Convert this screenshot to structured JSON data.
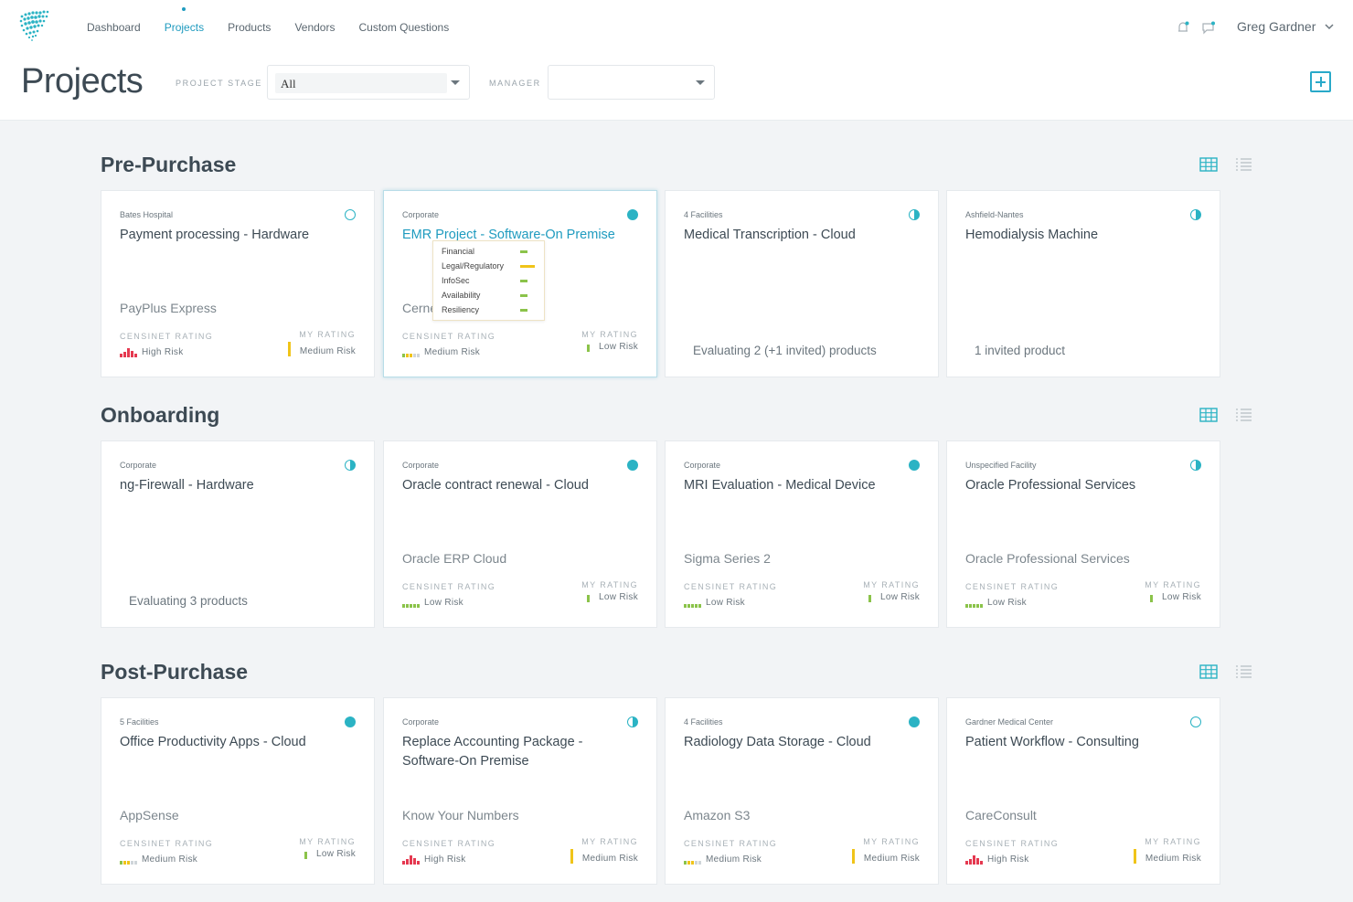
{
  "nav": {
    "items": [
      "Dashboard",
      "Projects",
      "Products",
      "Vendors",
      "Custom Questions"
    ],
    "active": "Projects"
  },
  "user": {
    "name": "Greg Gardner"
  },
  "page": {
    "title": "Projects"
  },
  "filters": {
    "stage_label": "PROJECT STAGE",
    "stage_value": "All",
    "manager_label": "MANAGER",
    "manager_value": ""
  },
  "labels": {
    "censinet_rating": "CENSINET RATING",
    "my_rating": "MY RATING"
  },
  "colors": {
    "accent": "#1f9bbf",
    "status": "#2bb3c4",
    "low": "#8bc34a",
    "medium": "#f0c419",
    "high": "#e53950"
  },
  "sections": [
    {
      "title": "Pre-Purchase",
      "cards": [
        {
          "facility": "Bates Hospital",
          "title": "Payment processing - Hardware",
          "status": "empty",
          "vendor": "PayPlus Express",
          "censinet": "High Risk",
          "my": "Medium Risk"
        },
        {
          "facility": "Corporate",
          "title": "EMR Project - Software-On Premise",
          "status": "full",
          "vendor": "Cerne",
          "censinet": "Medium Risk",
          "my": "Low Risk"
        },
        {
          "facility": "4 Facilities",
          "title": "Medical Transcription - Cloud",
          "status": "half",
          "eval": "Evaluating 2 (+1 invited) products"
        },
        {
          "facility": "Ashfield-Nantes",
          "title": "Hemodialysis Machine",
          "status": "half",
          "eval": "1 invited product"
        }
      ]
    },
    {
      "title": "Onboarding",
      "cards": [
        {
          "facility": "Corporate",
          "title": "ng-Firewall - Hardware",
          "status": "half",
          "eval": "Evaluating 3 products"
        },
        {
          "facility": "Corporate",
          "title": "Oracle contract renewal - Cloud",
          "status": "full",
          "vendor": "Oracle ERP Cloud",
          "censinet": "Low Risk",
          "my": "Low Risk"
        },
        {
          "facility": "Corporate",
          "title": "MRI Evaluation - Medical Device",
          "status": "full",
          "vendor": "Sigma Series 2",
          "censinet": "Low Risk",
          "my": "Low Risk"
        },
        {
          "facility": "Unspecified Facility",
          "title": "Oracle Professional Services",
          "status": "half",
          "vendor": "Oracle Professional Services",
          "censinet": "Low Risk",
          "my": "Low Risk"
        }
      ]
    },
    {
      "title": "Post-Purchase",
      "cards": [
        {
          "facility": "5 Facilities",
          "title": "Office Productivity Apps - Cloud",
          "status": "full",
          "vendor": "AppSense",
          "censinet": "Medium Risk",
          "my": "Low Risk"
        },
        {
          "facility": "Corporate",
          "title": "Replace Accounting Package - Software-On Premise",
          "status": "half",
          "vendor": "Know Your Numbers",
          "censinet": "High Risk",
          "my": "Medium Risk"
        },
        {
          "facility": "4 Facilities",
          "title": "Radiology Data Storage - Cloud",
          "status": "full",
          "vendor": "Amazon S3",
          "censinet": "Medium Risk",
          "my": "Medium Risk"
        },
        {
          "facility": "Gardner Medical Center",
          "title": "Patient Workflow - Consulting",
          "status": "empty",
          "vendor": "CareConsult",
          "censinet": "High Risk",
          "my": "Medium Risk"
        }
      ]
    }
  ],
  "tooltip": {
    "rows": [
      {
        "label": "Financial",
        "level": "Low Risk"
      },
      {
        "label": "Legal/Regulatory",
        "level": "Medium Risk"
      },
      {
        "label": "InfoSec",
        "level": "Low Risk"
      },
      {
        "label": "Availability",
        "level": "Low Risk"
      },
      {
        "label": "Resiliency",
        "level": "Low Risk"
      }
    ]
  }
}
